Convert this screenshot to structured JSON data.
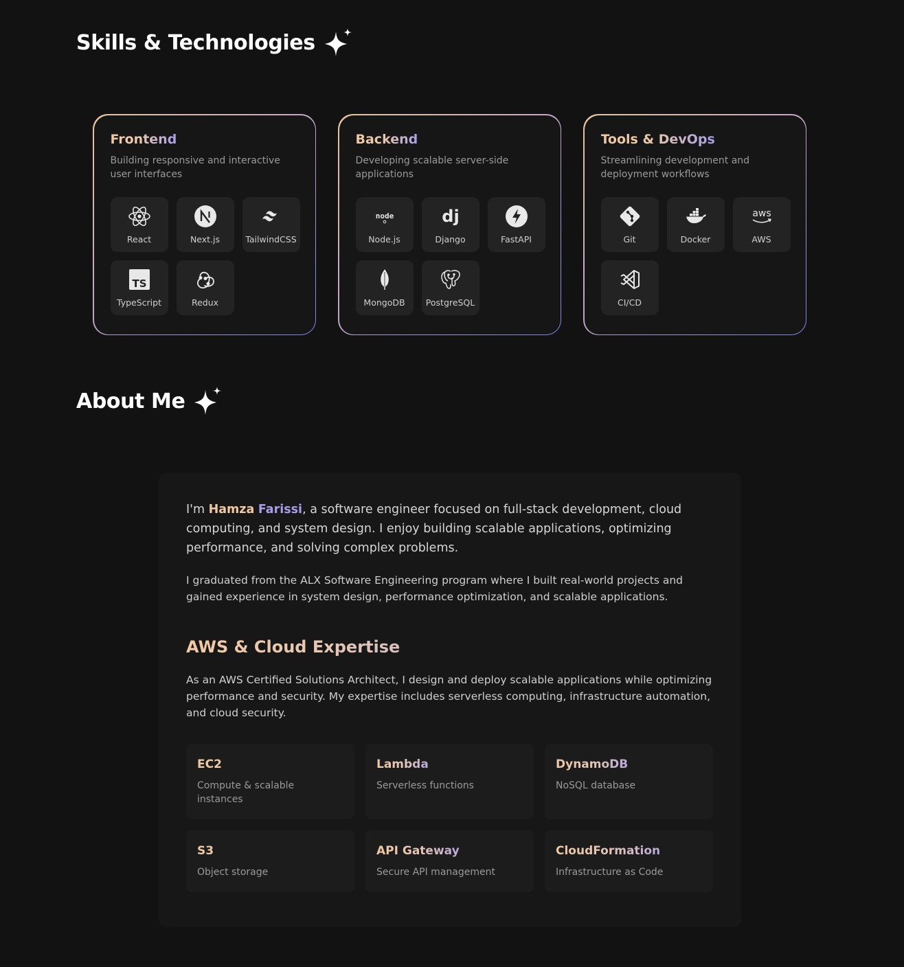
{
  "skills": {
    "title": "Skills & Technologies",
    "categories": [
      {
        "title": "Frontend",
        "description": "Building responsive and interactive user interfaces",
        "items": [
          {
            "label": "React",
            "icon": "react-icon"
          },
          {
            "label": "Next.js",
            "icon": "nextjs-icon"
          },
          {
            "label": "TailwindCSS",
            "icon": "tailwind-icon"
          },
          {
            "label": "TypeScript",
            "icon": "typescript-icon"
          },
          {
            "label": "Redux",
            "icon": "redux-icon"
          }
        ]
      },
      {
        "title": "Backend",
        "description": "Developing scalable server-side applications",
        "items": [
          {
            "label": "Node.js",
            "icon": "nodejs-icon"
          },
          {
            "label": "Django",
            "icon": "django-icon"
          },
          {
            "label": "FastAPI",
            "icon": "fastapi-icon"
          },
          {
            "label": "MongoDB",
            "icon": "mongodb-icon"
          },
          {
            "label": "PostgreSQL",
            "icon": "postgresql-icon"
          }
        ]
      },
      {
        "title": "Tools & DevOps",
        "description": "Streamlining development and deployment workflows",
        "items": [
          {
            "label": "Git",
            "icon": "git-icon"
          },
          {
            "label": "Docker",
            "icon": "docker-icon"
          },
          {
            "label": "AWS",
            "icon": "aws-icon"
          },
          {
            "label": "CI/CD",
            "icon": "cicd-icon"
          }
        ]
      }
    ]
  },
  "about": {
    "title": "About Me",
    "intro_prefix": "I'm ",
    "name_first": "Hamza",
    "name_last": "Farissi",
    "intro_suffix": ", a software engineer focused on full-stack development, cloud computing, and system design. I enjoy building scalable applications, optimizing performance, and solving complex problems.",
    "paragraph2": "I graduated from the ALX Software Engineering program where I built real-world projects and gained experience in system design, performance optimization, and scalable applications.",
    "aws_title": "AWS & Cloud Expertise",
    "aws_description": "As an AWS Certified Solutions Architect, I design and deploy scalable applications while optimizing performance and security. My expertise includes serverless computing, infrastructure automation, and cloud security.",
    "services": [
      {
        "name": "EC2",
        "description": "Compute & scalable instances"
      },
      {
        "name": "Lambda",
        "description": "Serverless functions"
      },
      {
        "name": "DynamoDB",
        "description": "NoSQL database"
      },
      {
        "name": "S3",
        "description": "Object storage"
      },
      {
        "name": "API Gateway",
        "description": "Secure API management"
      },
      {
        "name": "CloudFormation",
        "description": "Infrastructure as Code"
      }
    ]
  },
  "colors": {
    "background": "#121212",
    "accent_peach": "#f0c8a4",
    "accent_violet": "#a89ee8",
    "tile": "#232323"
  }
}
